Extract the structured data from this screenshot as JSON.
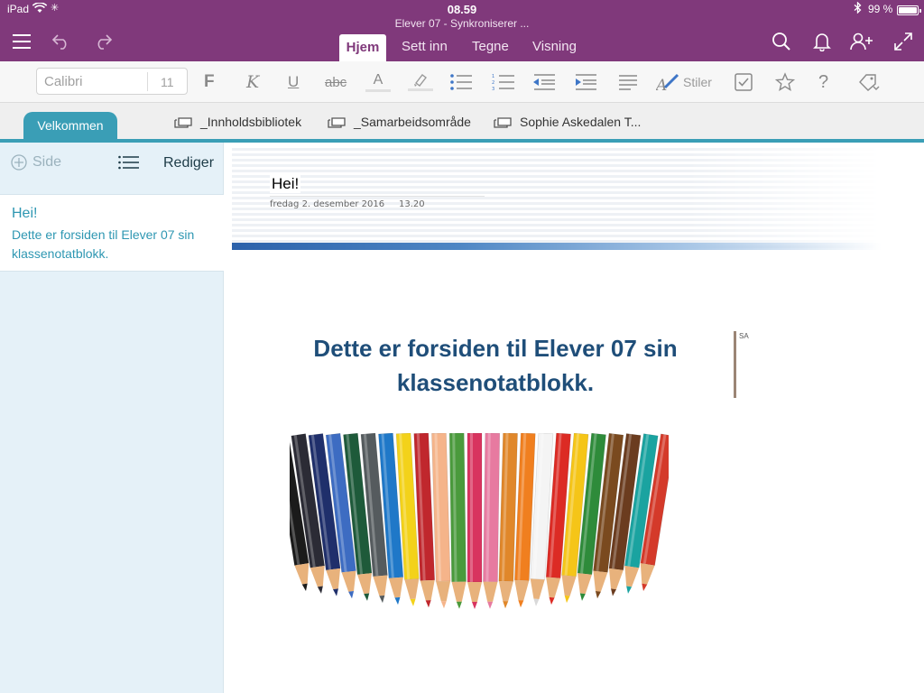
{
  "status": {
    "device": "iPad",
    "time": "08.59",
    "battery_text": "99 %",
    "battery_level": 0.99
  },
  "document_title": "Elever 07 - Synkroniserer ...",
  "ribbon_tabs": [
    "Hjem",
    "Sett inn",
    "Tegne",
    "Visning"
  ],
  "active_ribbon_tab": "Hjem",
  "toolbar": {
    "font_name": "Calibri",
    "font_size": "11",
    "bold_label": "F",
    "italic_label": "K",
    "underline_label": "U",
    "strikethrough_label": "abc",
    "font_color_label": "A",
    "styles_label": "Stiler"
  },
  "sections": {
    "active": "Velkommen",
    "notebook_links": [
      "_Innholdsbibliotek",
      "_Samarbeidsområde",
      "Sophie Askedalen T..."
    ]
  },
  "page_list": {
    "add_page_label": "Side",
    "edit_label": "Rediger",
    "pages": [
      {
        "title": "Hei!",
        "preview": "Dette er forsiden til Elever 07 sin klassenotatblokk."
      }
    ]
  },
  "page": {
    "title": "Hei!",
    "date": "fredag 2. desember 2016",
    "time": "13.20",
    "heading": "Dette er forsiden til Elever 07 sin klassenotatblokk.",
    "author_initials": "SA"
  },
  "colors": {
    "accent_purple": "#80397b",
    "section_teal": "#3a9eb6",
    "heading_blue": "#1f4e79",
    "pagelist_bg": "#e5f1f8"
  },
  "pencil_colors": [
    "#1b1b1b",
    "#2b2b35",
    "#1f2f6b",
    "#3d6cc2",
    "#1e5a3a",
    "#555b5e",
    "#1f78c8",
    "#f3d21a",
    "#c0272d",
    "#f5b48a",
    "#4a9a3c",
    "#d8345f",
    "#e77aa0",
    "#e0872a",
    "#f07f1f",
    "#f4f4f4",
    "#dc2b24",
    "#f5c518",
    "#2e8b3a",
    "#7a4a1f",
    "#6b3c1f",
    "#1aa3a0",
    "#d43a2a"
  ]
}
